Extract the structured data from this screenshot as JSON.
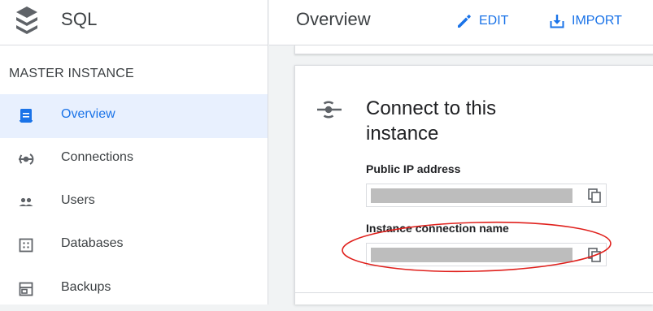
{
  "app": {
    "title": "SQL"
  },
  "sidebar": {
    "section_title": "MASTER INSTANCE",
    "items": [
      {
        "label": "Overview",
        "icon": "overview-icon",
        "active": true
      },
      {
        "label": "Connections",
        "icon": "connections-icon",
        "active": false
      },
      {
        "label": "Users",
        "icon": "users-icon",
        "active": false
      },
      {
        "label": "Databases",
        "icon": "databases-icon",
        "active": false
      },
      {
        "label": "Backups",
        "icon": "backups-icon",
        "active": false
      }
    ]
  },
  "header": {
    "title": "Overview",
    "edit_label": "EDIT",
    "import_label": "IMPORT"
  },
  "connect_card": {
    "title": "Connect to this instance",
    "public_ip_label": "Public IP address",
    "connection_name_label": "Instance connection name"
  },
  "colors": {
    "accent": "#1a73e8",
    "active_bg": "#e8f0fe",
    "annotation": "#e0201c"
  }
}
